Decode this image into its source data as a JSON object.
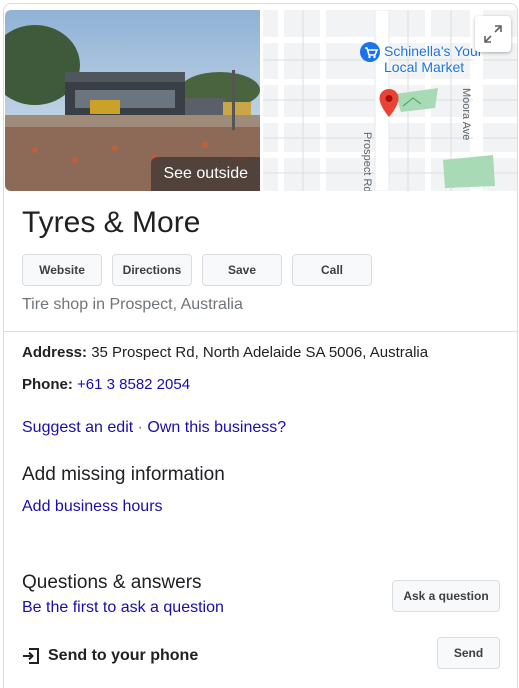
{
  "photo": {
    "overlay_label": "See outside"
  },
  "map": {
    "poi_name_line1": "Schinella's Your",
    "poi_name_line2": "Local Market",
    "street_1": "Prospect Rd",
    "street_2": "Moora Ave",
    "expand_icon": "expand-icon",
    "pin_color": "#ea4335"
  },
  "business": {
    "name": "Tyres & More",
    "category": "Tire shop in Prospect, Australia"
  },
  "actions": {
    "website": "Website",
    "directions": "Directions",
    "save": "Save",
    "call": "Call"
  },
  "info": {
    "address_label": "Address:",
    "address_value": "35 Prospect Rd, North Adelaide SA 5006, Australia",
    "phone_label": "Phone:",
    "phone_value": "+61 3 8582 2054"
  },
  "edit": {
    "suggest": "Suggest an edit",
    "separator": " · ",
    "own": "Own this business?"
  },
  "missing": {
    "title": "Add missing information",
    "hours_link": "Add business hours"
  },
  "qa": {
    "title": "Questions & answers",
    "first_link": "Be the first to ask a question",
    "ask_button": "Ask a question"
  },
  "phone_send": {
    "label": "Send to your phone",
    "button": "Send",
    "icon": "send-to-phone-icon"
  },
  "colors": {
    "link": "#1a0dab",
    "map_link": "#1a73e8",
    "muted": "#70757a"
  }
}
